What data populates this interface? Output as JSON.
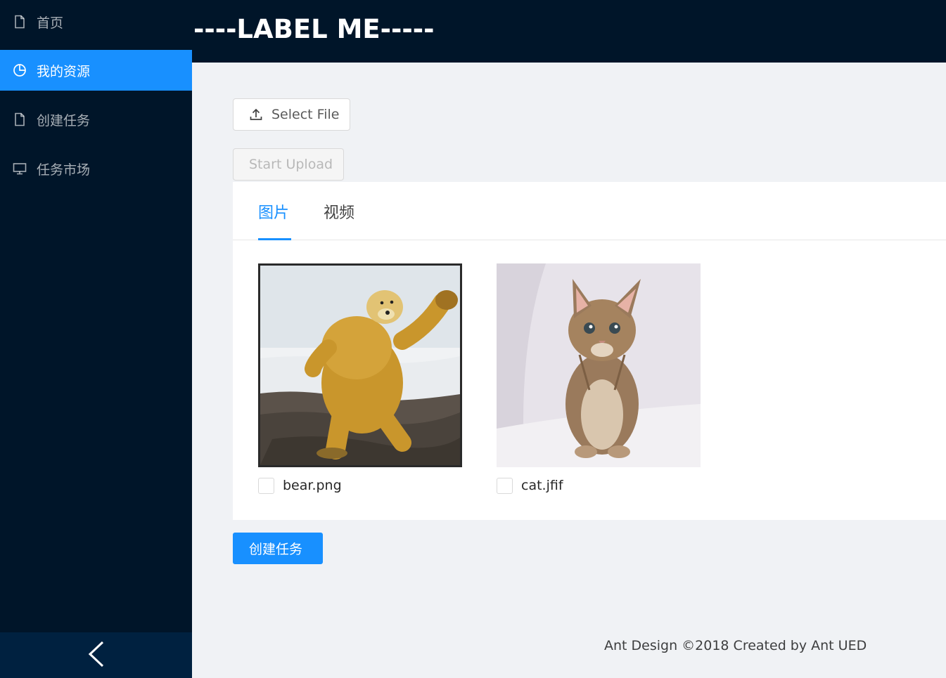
{
  "sidebar": {
    "items": [
      {
        "label": "首页",
        "icon": "file-icon"
      },
      {
        "label": "我的资源",
        "icon": "pie-chart-icon"
      },
      {
        "label": "创建任务",
        "icon": "file-icon"
      },
      {
        "label": "任务市场",
        "icon": "desktop-icon"
      }
    ],
    "active_index": 1,
    "collapse_icon": "chevron-left-icon"
  },
  "header": {
    "title": "----LABEL ME-----"
  },
  "upload": {
    "select_label": "Select File",
    "start_label": "Start Upload"
  },
  "tabs": [
    {
      "label": "图片"
    },
    {
      "label": "视频"
    }
  ],
  "files": [
    {
      "name": "bear.png"
    },
    {
      "name": "cat.jfif"
    }
  ],
  "create_button": "创建任务",
  "footer": {
    "text": "Ant Design ©2018 Created by Ant UED"
  },
  "colors": {
    "sidebar_bg": "#001529",
    "accent": "#1890ff",
    "content_bg": "#f0f2f5"
  }
}
